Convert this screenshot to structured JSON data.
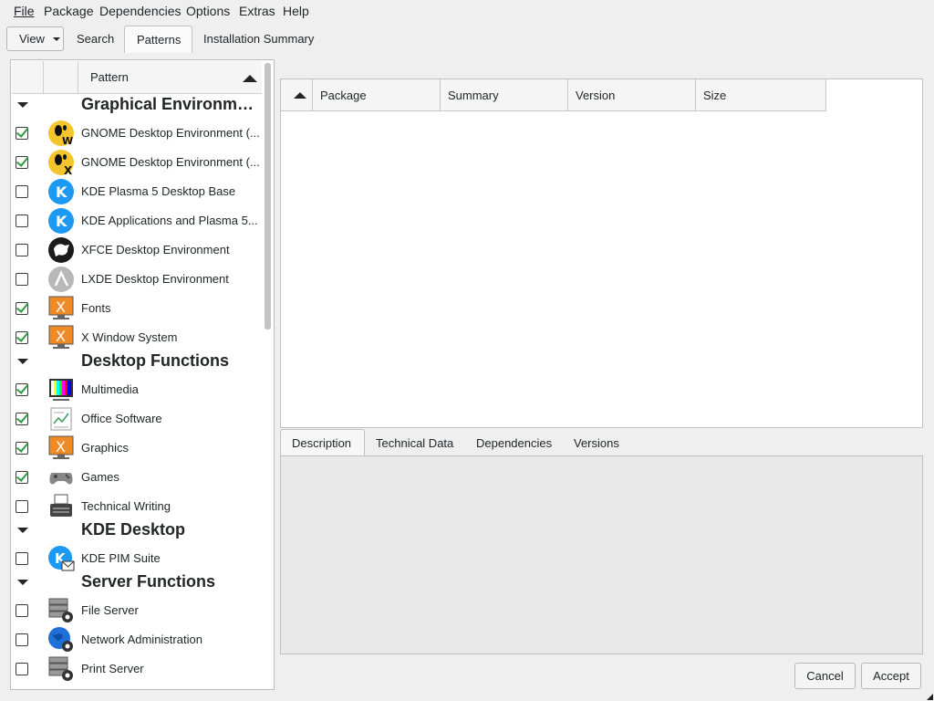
{
  "menu": [
    "File",
    "Package",
    "Dependencies",
    "Options",
    "Extras",
    "Help"
  ],
  "toolbar": {
    "view_label": "View",
    "tabs": [
      "Search",
      "Patterns",
      "Installation Summary"
    ],
    "active_tab": "Patterns"
  },
  "patterns": {
    "column_header": "Pattern",
    "groups": [
      {
        "title": "Graphical Environme...",
        "items": [
          {
            "label": "GNOME Desktop Environment (...",
            "checked": true,
            "icon": "gnome-wayland-icon"
          },
          {
            "label": "GNOME Desktop Environment (...",
            "checked": true,
            "icon": "gnome-x11-icon"
          },
          {
            "label": "KDE Plasma 5 Desktop Base",
            "checked": false,
            "icon": "kde-icon"
          },
          {
            "label": "KDE Applications and Plasma 5...",
            "checked": false,
            "icon": "kde-icon"
          },
          {
            "label": "XFCE Desktop Environment",
            "checked": false,
            "icon": "xfce-icon"
          },
          {
            "label": "LXDE Desktop Environment",
            "checked": false,
            "icon": "lxde-icon"
          },
          {
            "label": "Fonts",
            "checked": true,
            "icon": "x-window-icon"
          },
          {
            "label": "X Window System",
            "checked": true,
            "icon": "x-window-icon"
          }
        ]
      },
      {
        "title": "Desktop Functions",
        "items": [
          {
            "label": "Multimedia",
            "checked": true,
            "icon": "multimedia-icon"
          },
          {
            "label": "Office Software",
            "checked": true,
            "icon": "office-icon"
          },
          {
            "label": "Graphics",
            "checked": true,
            "icon": "x-window-icon"
          },
          {
            "label": "Games",
            "checked": true,
            "icon": "gamepad-icon"
          },
          {
            "label": "Technical Writing",
            "checked": false,
            "icon": "typewriter-icon"
          }
        ]
      },
      {
        "title": "KDE Desktop",
        "items": [
          {
            "label": "KDE PIM Suite",
            "checked": false,
            "icon": "kde-pim-icon"
          }
        ]
      },
      {
        "title": "Server Functions",
        "items": [
          {
            "label": "File Server",
            "checked": false,
            "icon": "server-gear-icon"
          },
          {
            "label": "Network Administration",
            "checked": false,
            "icon": "globe-gear-icon"
          },
          {
            "label": "Print Server",
            "checked": false,
            "icon": "server-gear-icon"
          }
        ]
      }
    ]
  },
  "packages_table": {
    "columns": [
      "Package",
      "Summary",
      "Version",
      "Size"
    ],
    "rows": []
  },
  "detail_tabs": [
    "Description",
    "Technical Data",
    "Dependencies",
    "Versions"
  ],
  "buttons": {
    "cancel": "Cancel",
    "accept": "Accept"
  }
}
